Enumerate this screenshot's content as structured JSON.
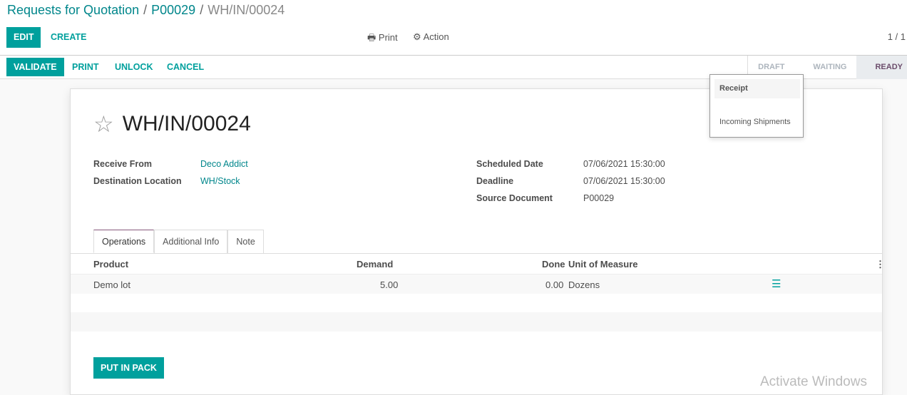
{
  "breadcrumb": [
    "Requests for Quotation",
    "P00029",
    "WH/IN/00024"
  ],
  "toolbar": {
    "edit": "EDIT",
    "create": "CREATE",
    "print": "Print",
    "action": "Action",
    "pager": "1 / 1"
  },
  "statusbar": {
    "buttons": [
      "VALIDATE",
      "PRINT",
      "UNLOCK",
      "CANCEL"
    ],
    "stages": [
      "DRAFT",
      "WAITING",
      "READY"
    ],
    "active_stage": "READY"
  },
  "record": {
    "title": "WH/IN/00024",
    "fields_left": [
      {
        "label": "Receive From",
        "value": "Deco Addict"
      },
      {
        "label": "Destination Location",
        "value": "WH/Stock"
      }
    ],
    "fields_right": [
      {
        "label": "Scheduled Date",
        "value": "07/06/2021 15:30:00"
      },
      {
        "label": "Deadline",
        "value": "07/06/2021 15:30:00"
      },
      {
        "label": "Source Document",
        "value": "P00029"
      }
    ]
  },
  "tabs": [
    "Operations",
    "Additional Info",
    "Note"
  ],
  "table": {
    "headers": [
      "Product",
      "Demand",
      "Done",
      "Unit of Measure"
    ],
    "rows": [
      {
        "product": "Demo lot",
        "demand": "5.00",
        "done": "0.00",
        "uom": "Dozens"
      }
    ]
  },
  "put_in_pack": "PUT IN PACK",
  "popover": {
    "title": "Receipt",
    "item": "Incoming Shipments"
  },
  "watermark": "Activate Windows",
  "colors": {
    "accent": "#00a09d",
    "tab_active": "#875a7b"
  }
}
